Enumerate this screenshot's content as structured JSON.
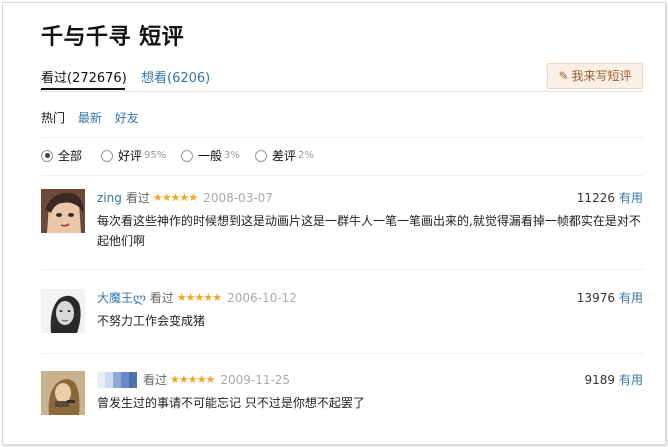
{
  "page": {
    "title": "千与千寻 短评"
  },
  "tabs": {
    "seen_label": "看过(272676)",
    "want_label": "想看(6206)",
    "write_label": "我来写短评"
  },
  "sort": {
    "hot": "热门",
    "latest": "最新",
    "friends": "好友"
  },
  "filters": {
    "all": "全部",
    "good": "好评",
    "good_pct": "95%",
    "mid": "一般",
    "mid_pct": "3%",
    "bad": "差评",
    "bad_pct": "2%",
    "selected": "全部"
  },
  "reviews": [
    {
      "user": "zing",
      "status": "看过",
      "stars": "★★★★★",
      "date": "2008-03-07",
      "votes": "11226",
      "useful": "有用",
      "text": "每次看这些神作的时候想到这是动画片这是一群牛人一笔一笔画出来的,就觉得漏看掉一帧都实在是对不起他们啊"
    },
    {
      "user": "大魔王ლ",
      "status": "看过",
      "stars": "★★★★★",
      "date": "2006-10-12",
      "votes": "13976",
      "useful": "有用",
      "text": "不努力工作会变成猪"
    },
    {
      "user": "",
      "status": "看过",
      "stars": "★★★★★",
      "date": "2009-11-25",
      "votes": "9189",
      "useful": "有用",
      "text": "曾发生过的事请不可能忘记 只不过是你想不起罢了"
    }
  ],
  "colors": {
    "link": "#3377aa",
    "star": "#f4a623",
    "write_button_bg": "#fbf0e6",
    "write_button_text": "#9b5d2f"
  },
  "icons": {
    "write": "pencil-icon",
    "avatar_3": "redacted-username-mosaic"
  }
}
